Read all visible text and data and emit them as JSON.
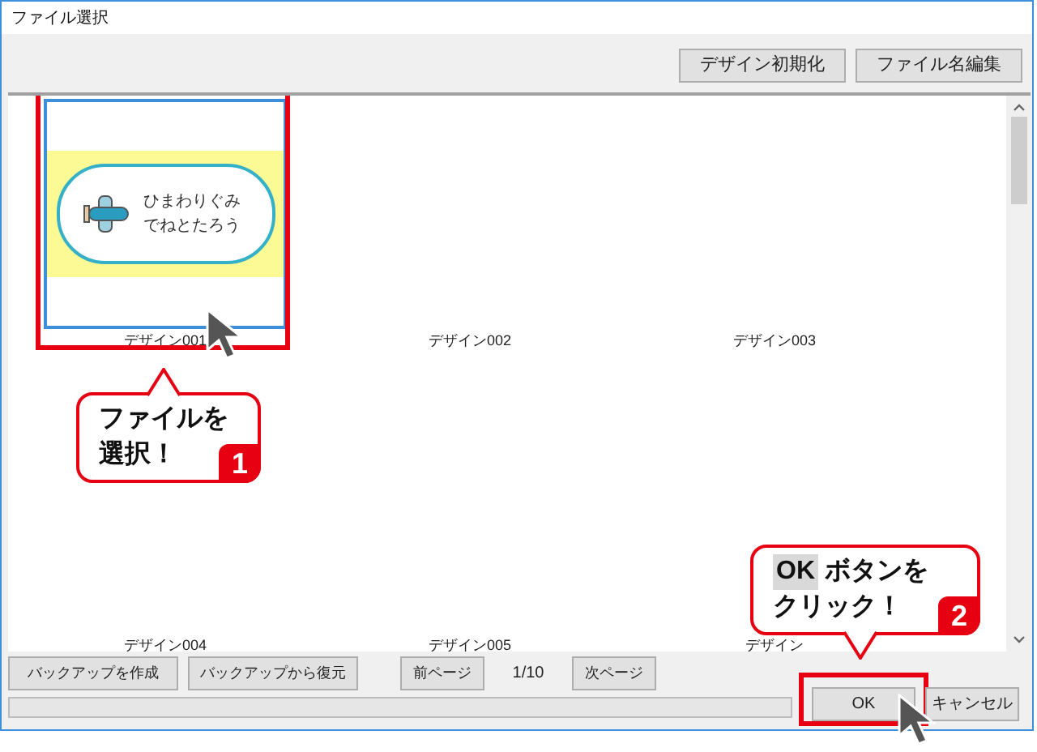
{
  "window": {
    "title": "ファイル選択"
  },
  "toolbar": {
    "buttons": [
      "デザイン初期化",
      "ファイル名編集"
    ]
  },
  "designs": [
    {
      "label": "デザイン001",
      "selected": true,
      "highlighted": true,
      "thumbnail": {
        "lines": [
          "ひまわりぐみ",
          "でねとたろう"
        ]
      }
    },
    {
      "label": "デザイン002",
      "selected": false,
      "highlighted": false
    },
    {
      "label": "デザイン003",
      "selected": false,
      "highlighted": false
    },
    {
      "label": "デザイン004",
      "selected": false,
      "highlighted": false
    },
    {
      "label": "デザイン005",
      "selected": false,
      "highlighted": false
    },
    {
      "label": "デザイン",
      "selected": false,
      "highlighted": false
    }
  ],
  "footer": {
    "buttons": [
      "バックアップを作成",
      "バックアップから復元"
    ],
    "prev": "前ページ",
    "page": "1/10",
    "next": "次ページ",
    "progress": {
      "level": 0
    }
  },
  "dialog_buttons": [
    {
      "label": "OK",
      "highlighted": true
    },
    {
      "label": "キャンセル",
      "highlighted": false
    }
  ],
  "callouts": [
    {
      "lines": [
        "ファイルを",
        "選択！"
      ],
      "badge": "1"
    },
    {
      "key_label": "OK",
      "lines": [
        "ボタンを",
        "クリック！"
      ],
      "badge": "2"
    }
  ]
}
